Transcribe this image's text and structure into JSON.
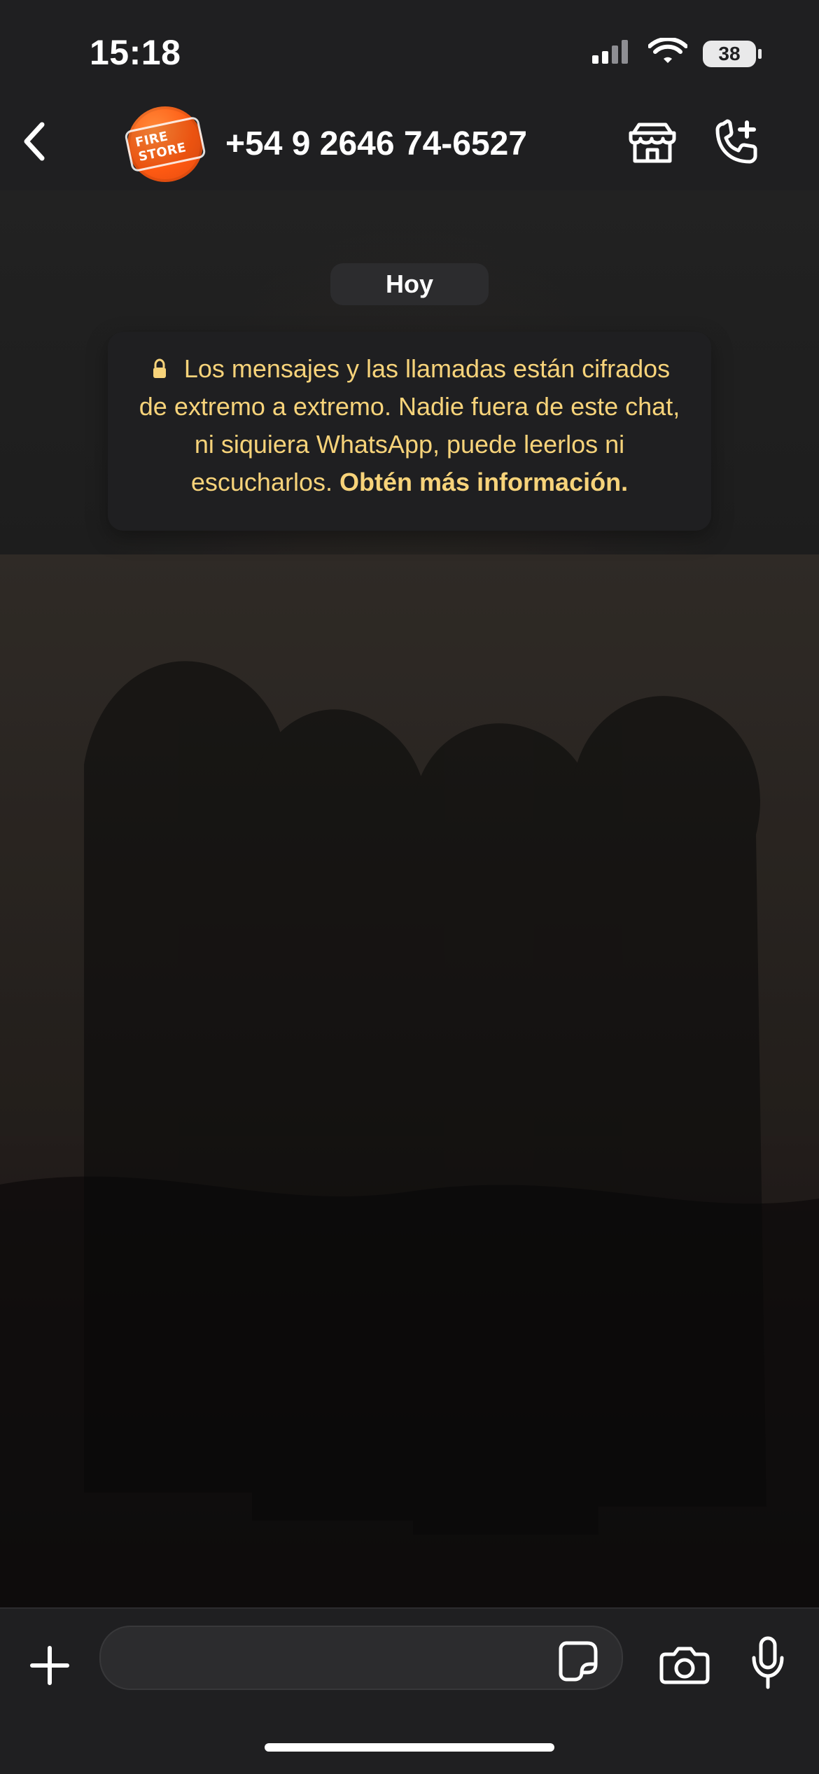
{
  "status_bar": {
    "time": "15:18",
    "battery_percent": "38",
    "icons": [
      "signal-icon",
      "wifi-icon",
      "battery-icon"
    ]
  },
  "header": {
    "back_icon": "chevron-left-icon",
    "avatar": {
      "logo_text": "FIRE STORE",
      "color": "#FF5A12"
    },
    "contact_name": "+54 9 2646 74-6527",
    "icons": [
      "store-icon",
      "phone-plus-icon"
    ]
  },
  "chat": {
    "date_label": "Hoy",
    "e2e": {
      "text": "Los mensajes y las llamadas están cifrados de extremo a extremo. Nadie fuera de este chat, ni siquiera WhatsApp, puede leerlos ni escucharlos.",
      "link": "Obtén más información.",
      "text_color": "#F7D37A"
    }
  },
  "composer": {
    "input_value": "",
    "icons": [
      "plus-icon",
      "sticker-icon",
      "camera-icon",
      "microphone-icon"
    ]
  },
  "theme": {
    "background": "#0B0B0B",
    "bar_background": "#1F1F21",
    "pill_background": "#2C2C2E",
    "accent": "#FF5A12"
  }
}
